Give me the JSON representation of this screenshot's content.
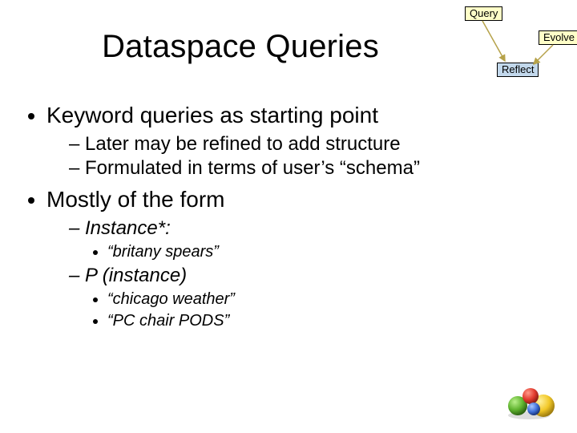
{
  "title": "Dataspace Queries",
  "diagram": {
    "query": "Query",
    "evolve": "Evolve",
    "reflect": "Reflect"
  },
  "bullets": {
    "b1": "Keyword queries as starting point",
    "b1_sub1": "Later may be refined to add structure",
    "b1_sub2": "Formulated in terms of user’s “schema”",
    "b2": "Mostly of the form",
    "b2_sub1": "Instance*:",
    "b2_sub1_ex1": "“britany spears”",
    "b2_sub2": "P (instance)",
    "b2_sub2_ex1": "“chicago weather”",
    "b2_sub2_ex2": "“PC chair PODS”"
  }
}
